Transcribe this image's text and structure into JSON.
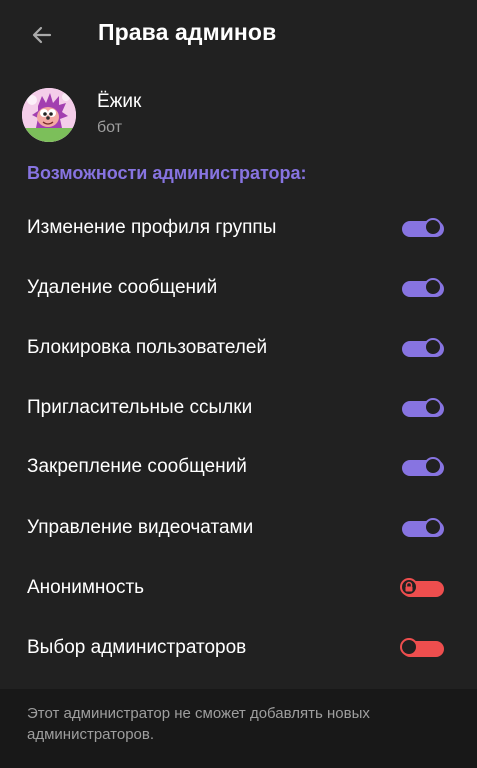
{
  "header": {
    "back_icon": "arrow-left-icon",
    "title": "Права админов"
  },
  "user": {
    "name": "Ёжик",
    "status": "бот",
    "avatar_icon": "hedgehog-avatar"
  },
  "section": {
    "title": "Возможности администратора:"
  },
  "permissions": [
    {
      "label": "Изменение профиля группы",
      "enabled": true,
      "locked": false
    },
    {
      "label": "Удаление сообщений",
      "enabled": true,
      "locked": false
    },
    {
      "label": "Блокировка пользователей",
      "enabled": true,
      "locked": false
    },
    {
      "label": "Пригласительные ссылки",
      "enabled": true,
      "locked": false
    },
    {
      "label": "Закрепление сообщений",
      "enabled": true,
      "locked": false
    },
    {
      "label": "Управление видеочатами",
      "enabled": true,
      "locked": false
    },
    {
      "label": "Анонимность",
      "enabled": false,
      "locked": true
    },
    {
      "label": "Выбор администраторов",
      "enabled": false,
      "locked": false
    }
  ],
  "footer": {
    "note": "Этот администратор не сможет добавлять новых администраторов."
  },
  "colors": {
    "background": "#212121",
    "accent": "#8774e1",
    "toggle_off": "#ee4e4e",
    "secondary_text": "#9e9e9e",
    "footer_background": "#181818"
  }
}
